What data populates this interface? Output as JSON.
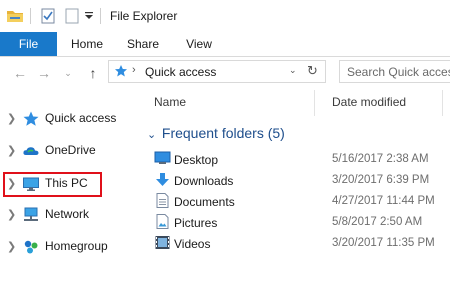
{
  "window": {
    "title": "File Explorer"
  },
  "ribbon": {
    "tabs": [
      {
        "label": "File"
      },
      {
        "label": "Home"
      },
      {
        "label": "Share"
      },
      {
        "label": "View"
      }
    ]
  },
  "address": {
    "path": "Quick access",
    "search_placeholder": "Search Quick access"
  },
  "nav_pane": {
    "items": [
      {
        "label": "Quick access",
        "icon": "star-icon"
      },
      {
        "label": "OneDrive",
        "icon": "cloud-icon"
      },
      {
        "label": "This PC",
        "icon": "computer-icon"
      },
      {
        "label": "Network",
        "icon": "network-icon"
      },
      {
        "label": "Homegroup",
        "icon": "homegroup-icon"
      }
    ]
  },
  "content": {
    "columns": {
      "name": "Name",
      "date_modified": "Date modified"
    },
    "group_title": "Frequent folders (5)",
    "rows": [
      {
        "name": "Desktop",
        "date": "5/16/2017 2:38 AM",
        "icon": "desktop-icon"
      },
      {
        "name": "Downloads",
        "date": "3/20/2017 6:39 PM",
        "icon": "download-icon"
      },
      {
        "name": "Documents",
        "date": "4/27/2017 11:44 PM",
        "icon": "document-icon"
      },
      {
        "name": "Pictures",
        "date": "5/8/2017 2:50 AM",
        "icon": "pictures-icon"
      },
      {
        "name": "Videos",
        "date": "3/20/2017 11:35 PM",
        "icon": "video-icon"
      }
    ]
  },
  "colors": {
    "accent": "#1979ca",
    "group_header": "#1e4e8c",
    "highlight_border": "#e0101a"
  }
}
